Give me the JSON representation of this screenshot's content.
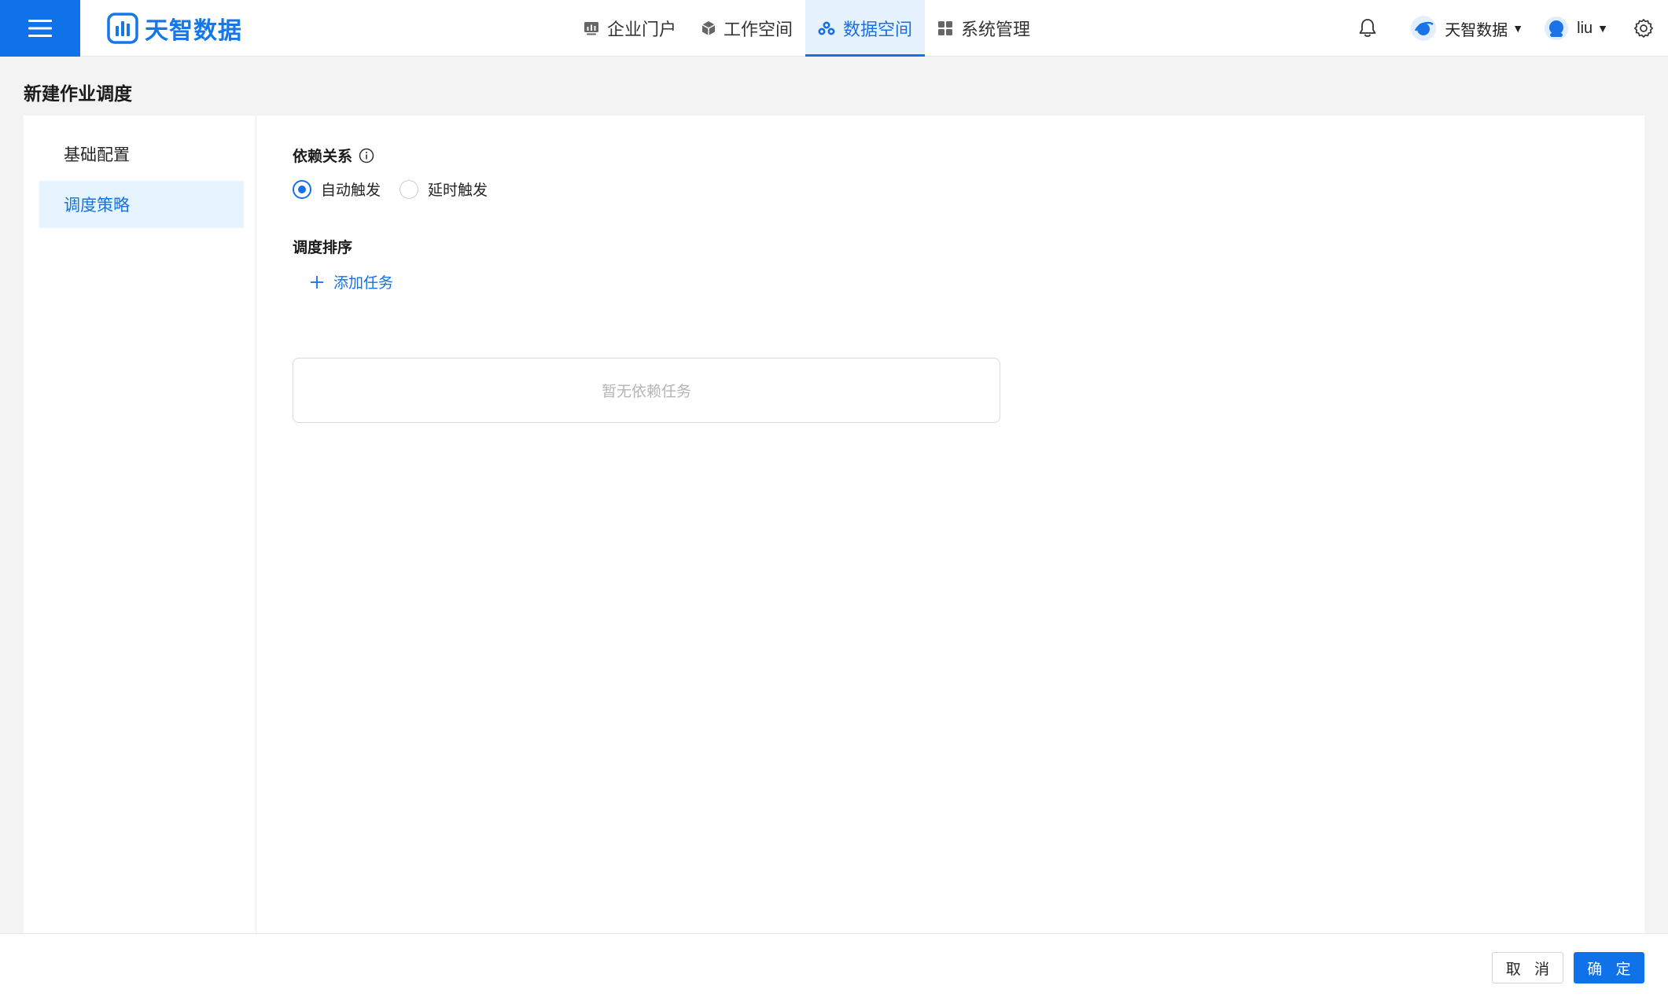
{
  "header": {
    "logo_text": "天智数据",
    "nav": [
      {
        "label": "企业门户",
        "icon": "dashboard-icon"
      },
      {
        "label": "工作空间",
        "icon": "cube-icon"
      },
      {
        "label": "数据空间",
        "icon": "cluster-icon",
        "active": true
      },
      {
        "label": "系统管理",
        "icon": "apps-grid-icon"
      }
    ],
    "org_name": "天智数据",
    "username": "liu"
  },
  "page": {
    "title": "新建作业调度"
  },
  "sidebar": {
    "items": [
      {
        "label": "基础配置",
        "active": false
      },
      {
        "label": "调度策略",
        "active": true
      }
    ]
  },
  "form": {
    "dependency_label": "依赖关系",
    "trigger_options": [
      {
        "label": "自动触发",
        "checked": true
      },
      {
        "label": "延时触发",
        "checked": false
      }
    ],
    "order_label": "调度排序",
    "add_task_label": "添加任务",
    "empty_text": "暂无依赖任务"
  },
  "footer": {
    "cancel_label": "取 消",
    "ok_label": "确 定"
  },
  "colors": {
    "primary": "#1670e6",
    "active_bg": "#e6f2fe"
  }
}
